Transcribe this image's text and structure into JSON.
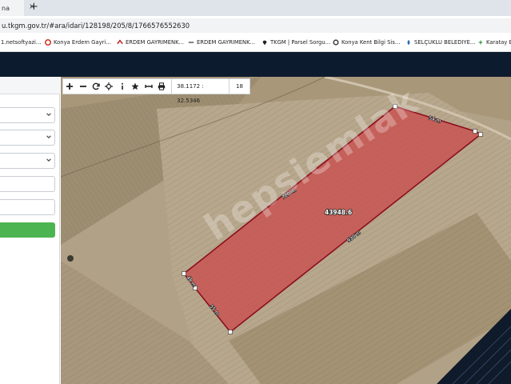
{
  "browser": {
    "tab_title": "na",
    "url": "u.tkgm.gov.tr/#ara/idari/128198/205/8/1766576552630"
  },
  "bookmarks": [
    {
      "label": "1.netsoftyazi...",
      "icon": "dot-icon",
      "color": "#888888"
    },
    {
      "label": "Konya Erdem Gayri...",
      "icon": "g-icon",
      "color": "#d23a2a"
    },
    {
      "label": "ERDEM GAYRIMENK...",
      "icon": "roof-icon",
      "color": "#c62828"
    },
    {
      "label": "ERDEM GAYRIMENK...",
      "icon": "dash-icon",
      "color": "#666666"
    },
    {
      "label": "TKGM | Parsel Sorgu...",
      "icon": "pin-icon",
      "color": "#222222"
    },
    {
      "label": "Konya Kent Bilgi Sis...",
      "icon": "gear-icon",
      "color": "#444444"
    },
    {
      "label": "SELÇUKLU BELEDIYE...",
      "icon": "drop-icon",
      "color": "#2b6cb0"
    },
    {
      "label": "Karatay B",
      "icon": "leaf-icon",
      "color": "#3a9a3a"
    }
  ],
  "map": {
    "coords": "38.1172 : 32.5346",
    "zoom": "18",
    "watermark": "hepsiemlak",
    "parcel_area": "43948.6",
    "edges": [
      "720 m",
      "54 m",
      "930 m",
      "55 m",
      "48 m"
    ],
    "parcel_color": "#c94a4a",
    "parcel_stroke": "#8c0d1e"
  }
}
